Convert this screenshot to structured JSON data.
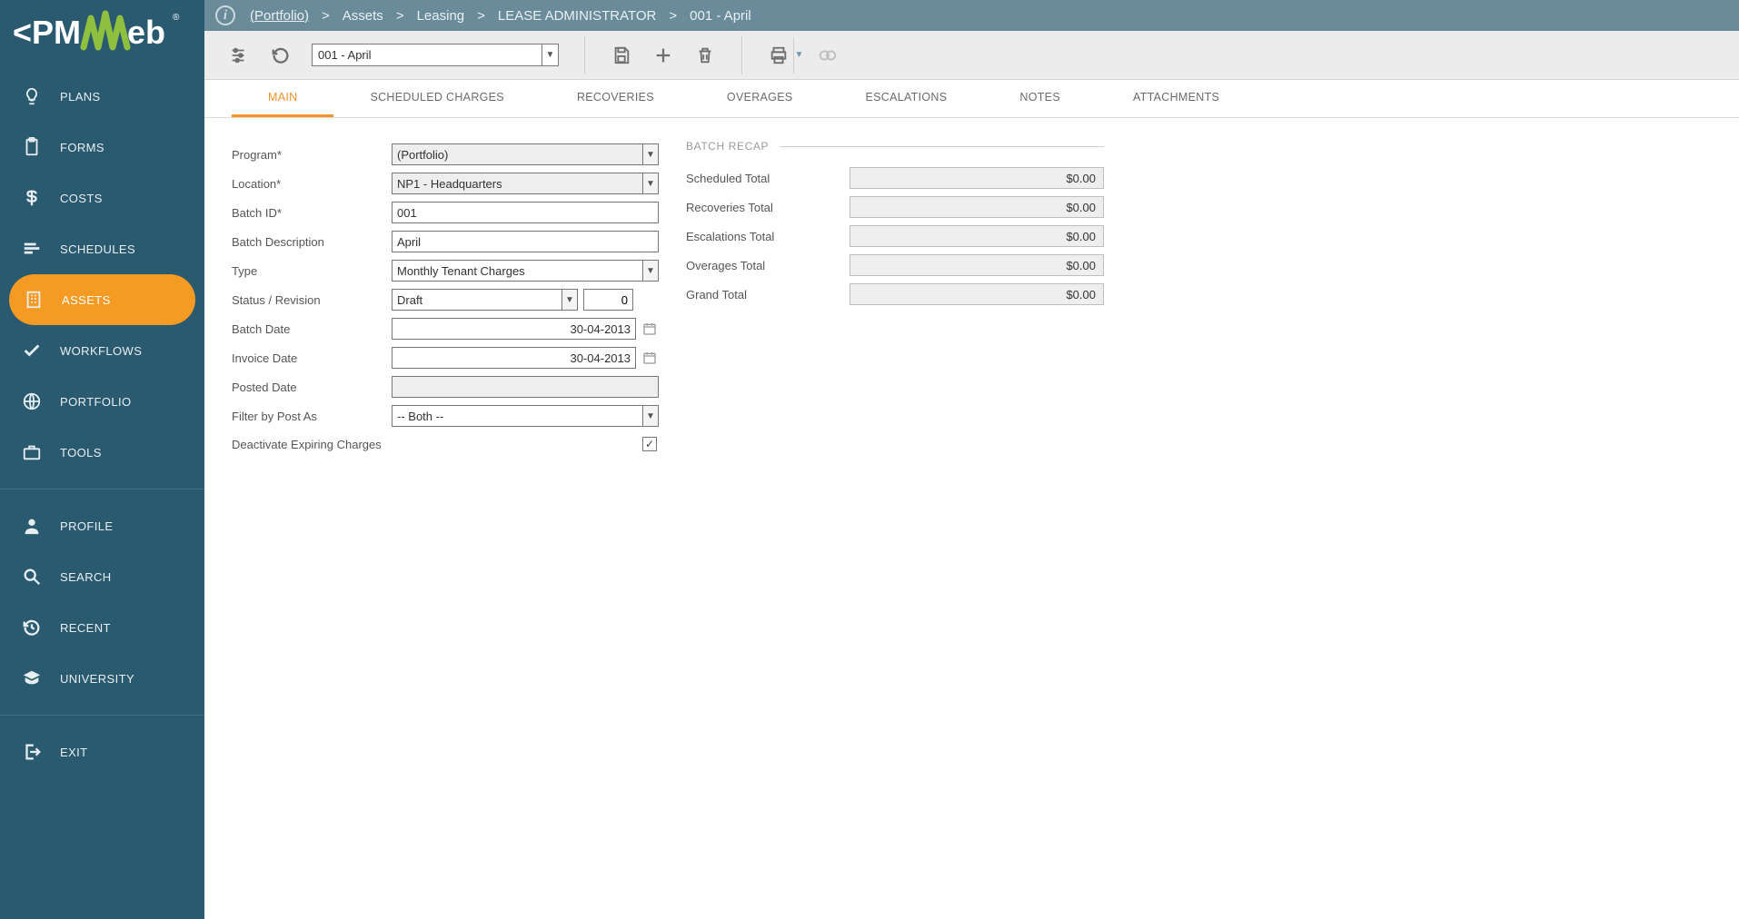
{
  "breadcrumb": {
    "root": "(Portfolio)",
    "seg1": "Assets",
    "seg2": "Leasing",
    "seg3": "LEASE ADMINISTRATOR",
    "seg4": "001 - April",
    "sep": ">"
  },
  "sidebar": {
    "items": {
      "plans": "PLANS",
      "forms": "FORMS",
      "costs": "COSTS",
      "schedules": "SCHEDULES",
      "assets": "ASSETS",
      "workflows": "WORKFLOWS",
      "portfolio": "PORTFOLIO",
      "tools": "TOOLS",
      "profile": "PROFILE",
      "search": "SEARCH",
      "recent": "RECENT",
      "university": "UNIVERSITY",
      "exit": "EXIT"
    }
  },
  "toolbar": {
    "record": "001 -  April"
  },
  "tabs": {
    "main": "MAIN",
    "scheduled": "SCHEDULED CHARGES",
    "recoveries": "RECOVERIES",
    "overages": "OVERAGES",
    "escalations": "ESCALATIONS",
    "notes": "NOTES",
    "attachments": "ATTACHMENTS"
  },
  "form": {
    "labels": {
      "program": "Program*",
      "location": "Location*",
      "batch_id": "Batch ID*",
      "batch_desc": "Batch Description",
      "type": "Type",
      "status": "Status / Revision",
      "batch_date": "Batch Date",
      "invoice_date": "Invoice Date",
      "posted_date": "Posted Date",
      "filter_post": "Filter by Post As",
      "deactivate": "Deactivate Expiring Charges"
    },
    "values": {
      "program": "(Portfolio)",
      "location": "NP1 - Headquarters",
      "batch_id": "001",
      "batch_desc": "April",
      "type": "Monthly Tenant Charges",
      "status": "Draft",
      "revision": "0",
      "batch_date": "30-04-2013",
      "invoice_date": "30-04-2013",
      "posted_date": "",
      "filter_post": "-- Both --",
      "deactivate_checked": "✓"
    }
  },
  "recap": {
    "header": "BATCH RECAP",
    "labels": {
      "scheduled": "Scheduled Total",
      "recoveries": "Recoveries Total",
      "escalations": "Escalations Total",
      "overages": "Overages Total",
      "grand": "Grand Total"
    },
    "values": {
      "scheduled": "$0.00",
      "recoveries": "$0.00",
      "escalations": "$0.00",
      "overages": "$0.00",
      "grand": "$0.00"
    }
  }
}
